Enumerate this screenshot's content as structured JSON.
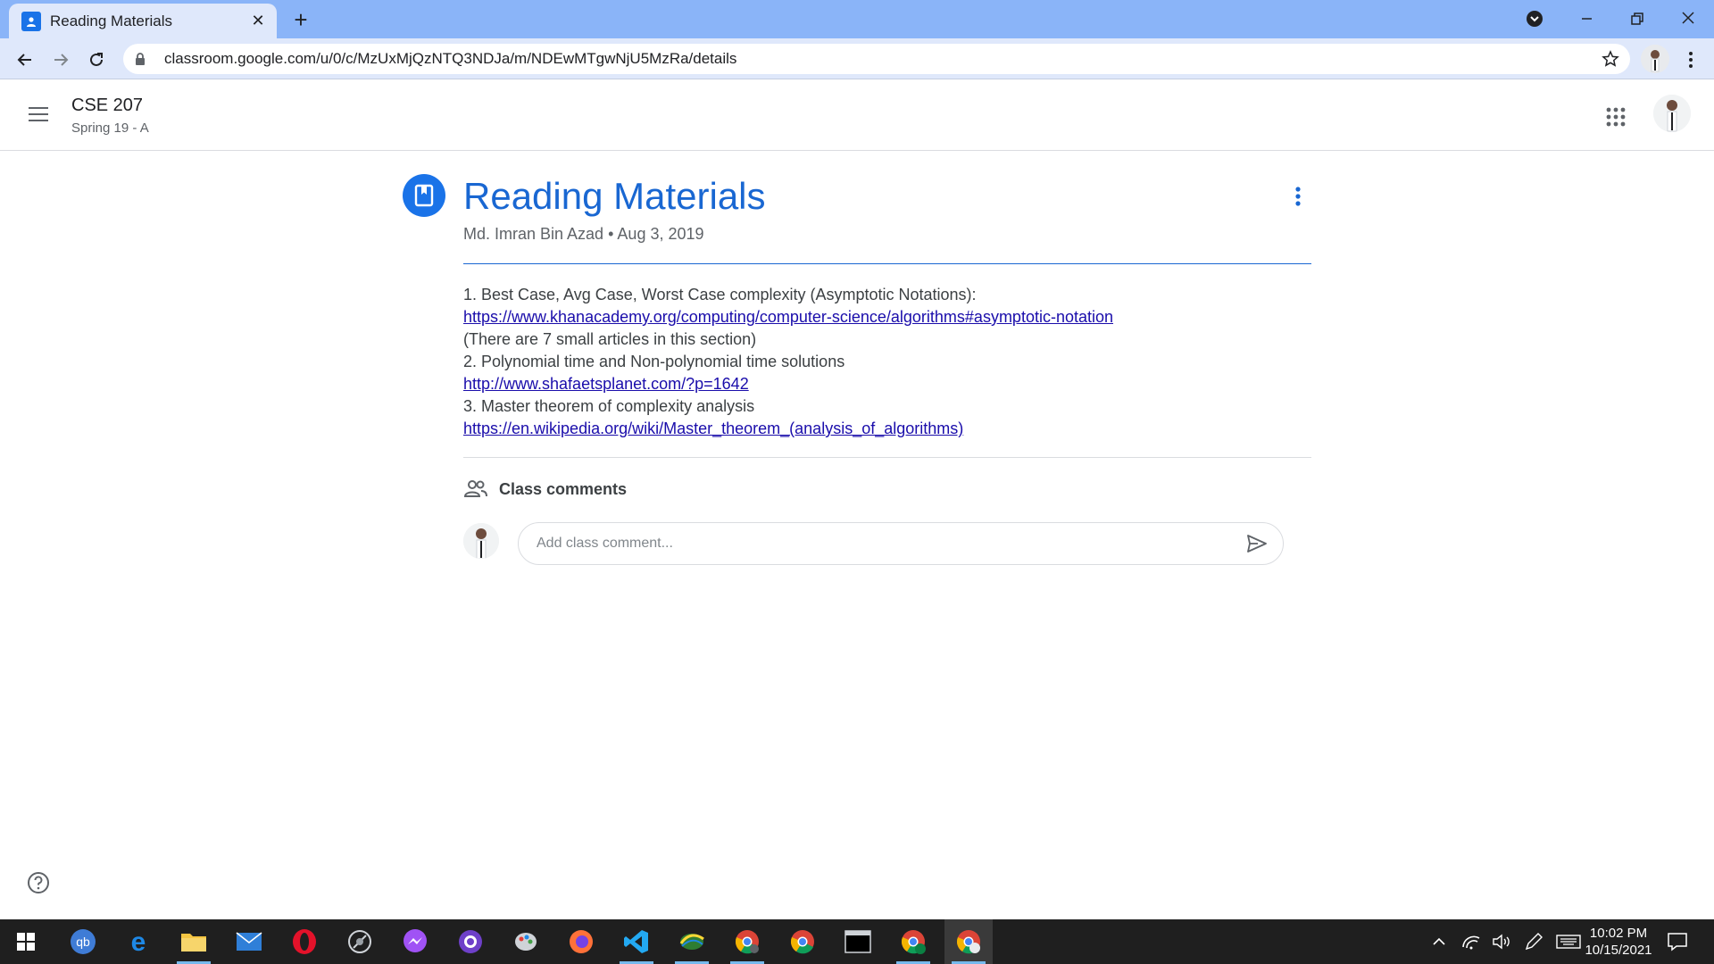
{
  "browser": {
    "tab_title": "Reading Materials",
    "url": "classroom.google.com/u/0/c/MzUxMjQzNTQ3NDJa/m/NDEwMTgwNjU5MzRa/details"
  },
  "header": {
    "course_name": "CSE 207",
    "course_section": "Spring 19 - A"
  },
  "post": {
    "title": "Reading Materials",
    "author": "Md. Imran Bin Azad",
    "separator": "•",
    "date": "Aug 3, 2019",
    "lines": [
      {
        "type": "text",
        "text": "1. Best Case, Avg Case, Worst Case complexity (Asymptotic Notations):"
      },
      {
        "type": "link",
        "text": "https://www.khanacademy.org/computing/computer-science/algorithms#asymptotic-notation"
      },
      {
        "type": "text",
        "text": "(There are 7 small articles in this section)"
      },
      {
        "type": "text",
        "text": "2. Polynomial time and Non-polynomial time solutions"
      },
      {
        "type": "link",
        "text": "http://www.shafaetsplanet.com/?p=1642"
      },
      {
        "type": "text",
        "text": "3. Master theorem of complexity analysis"
      },
      {
        "type": "link",
        "text": "https://en.wikipedia.org/wiki/Master_theorem_(analysis_of_algorithms)"
      }
    ]
  },
  "comments": {
    "label": "Class comments",
    "placeholder": "Add class comment..."
  },
  "taskbar": {
    "time": "10:02 PM",
    "date": "10/15/2021"
  },
  "colors": {
    "accent": "#1967d2",
    "icon_bg": "#1a73e8",
    "tabbar": "#8ab4f8",
    "toolbar": "#dfe8fb",
    "taskbar": "#1f1f1f"
  }
}
